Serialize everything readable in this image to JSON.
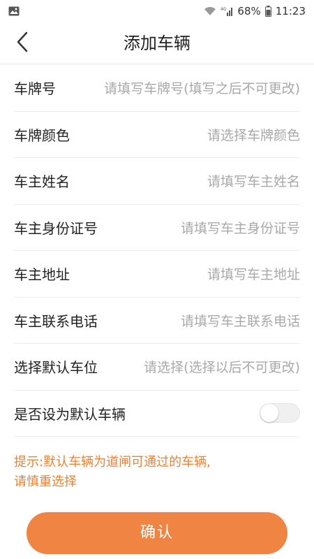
{
  "status_bar": {
    "battery": "68%",
    "time": "11:23",
    "network_label": "4G"
  },
  "header": {
    "title": "添加车辆"
  },
  "form": {
    "rows": [
      {
        "label": "车牌号",
        "placeholder": "请填写车牌号(填写之后不可更改)"
      },
      {
        "label": "车牌颜色",
        "placeholder": "请选择车牌颜色"
      },
      {
        "label": "车主姓名",
        "placeholder": "请填写车主姓名"
      },
      {
        "label": "车主身份证号",
        "placeholder": "请填写车主身份证号"
      },
      {
        "label": "车主地址",
        "placeholder": "请填写车主地址"
      },
      {
        "label": "车主联系电话",
        "placeholder": "请填写车主联系电话"
      },
      {
        "label": "选择默认车位",
        "placeholder": "请选择(选择以后不可更改)"
      }
    ],
    "default_toggle": {
      "label": "是否设为默认车辆",
      "on": false
    }
  },
  "tip": {
    "line1": "提示:默认车辆为道闸可通过的车辆,",
    "line2": "请慎重选择"
  },
  "confirm_button": {
    "label": "确认"
  },
  "colors": {
    "accent": "#f08443",
    "tip_text": "#ee8136",
    "placeholder": "#a8a8a8"
  },
  "icons": {
    "status_left": "image-icon",
    "back": "chevron-left-icon",
    "wifi": "wifi-icon",
    "signal": "signal-icon",
    "battery": "battery-icon"
  }
}
